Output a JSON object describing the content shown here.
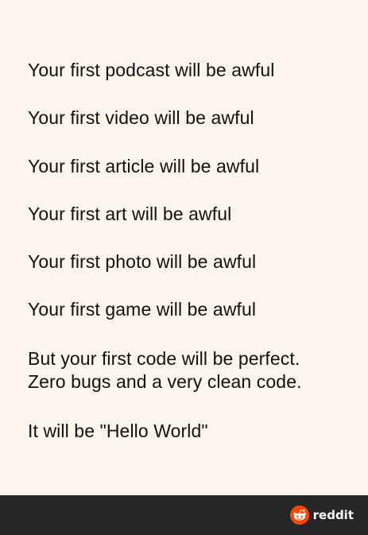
{
  "lines": [
    "Your first podcast will be awful",
    "Your first video will be awful",
    "Your first article will be awful",
    "Your first art will be awful",
    "Your first photo will be awful",
    "Your first game will be awful",
    "But your first code will be perfect.",
    "Zero bugs and a very clean code.",
    "It will be \"Hello World\""
  ],
  "footer": {
    "brand_label": "reddit",
    "brand_icon": "reddit-logo-icon",
    "background_color": "#262626",
    "icon_color": "#ff4500"
  },
  "colors": {
    "background": "#fbf5ec",
    "text": "#111111"
  }
}
